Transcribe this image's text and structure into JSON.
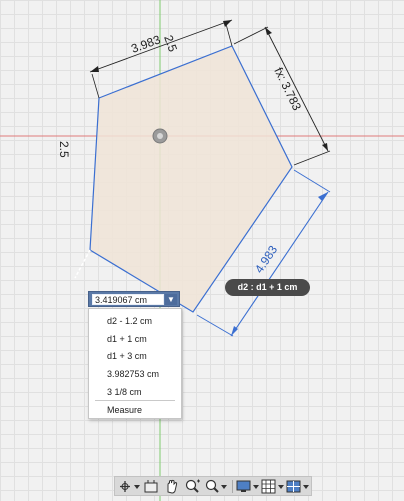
{
  "dimensions": {
    "top_length": "3.983",
    "top_partial_label": "2.5",
    "right_fixed": "fx: 3.783",
    "left_axis_label": "2.5",
    "active_length": "4.983"
  },
  "dimension_input": {
    "value": "3.419067 cm"
  },
  "dropdown": {
    "items": [
      "d2 - 1.2 cm",
      "d1 + 1 cm",
      "d1 + 3 cm",
      "3.982753 cm",
      "3 1/8 cm"
    ],
    "measure_label": "Measure"
  },
  "tooltip": {
    "text": "d2 : d1 + 1 cm"
  },
  "toolbar": {
    "icons": [
      "orbit-icon",
      "look-at-icon",
      "pan-icon",
      "zoom-icon",
      "fit-icon",
      "display-settings-icon",
      "grid-settings-icon",
      "viewports-icon"
    ]
  },
  "colors": {
    "selected_edge": "#3b6fd1",
    "profile_fill": "#f0e4d7",
    "x_axis": "#e07a7a",
    "y_axis": "#7fcb6f",
    "tooltip_bg": "#4a4a4a",
    "input_bg": "#5a79a7"
  }
}
